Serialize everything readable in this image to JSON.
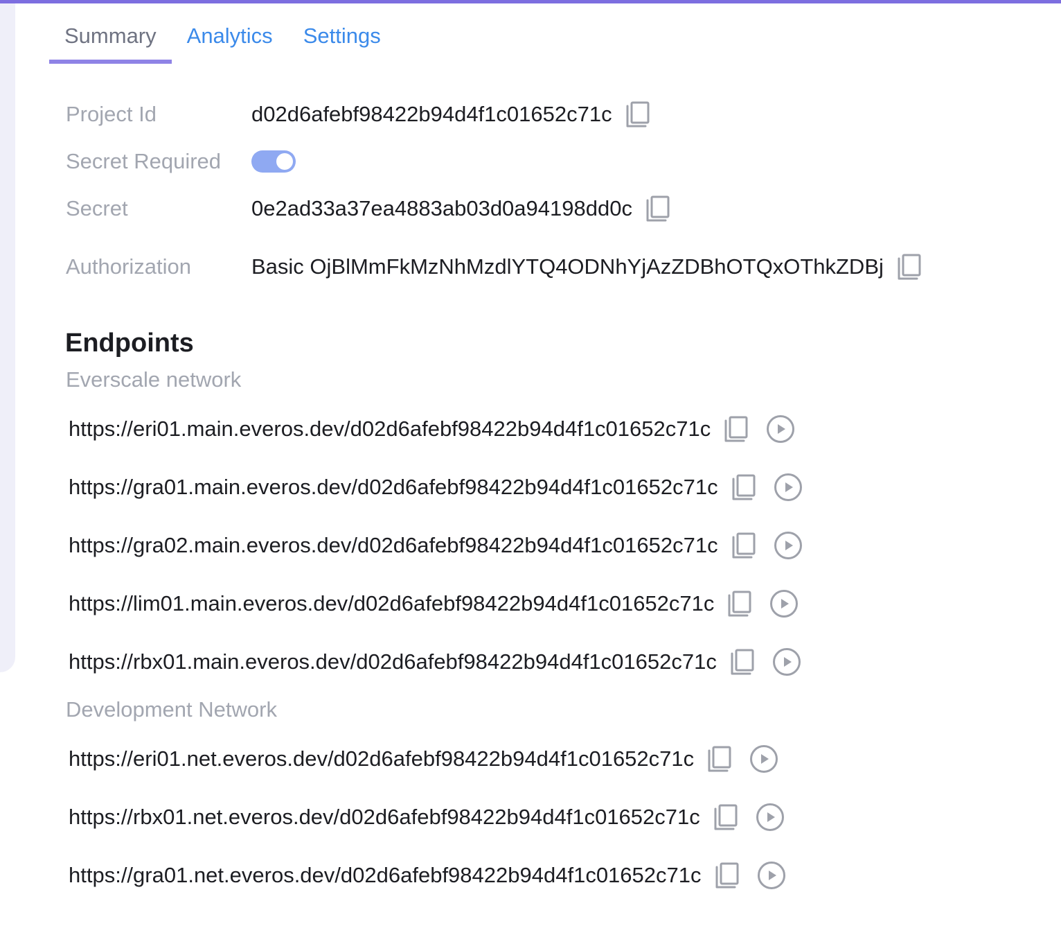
{
  "tabs": [
    {
      "label": "Summary",
      "active": true
    },
    {
      "label": "Analytics",
      "active": false
    },
    {
      "label": "Settings",
      "active": false
    }
  ],
  "project": {
    "project_id_label": "Project Id",
    "project_id": "d02d6afebf98422b94d4f1c01652c71c",
    "secret_required_label": "Secret Required",
    "secret_required": true,
    "secret_label": "Secret",
    "secret": "0e2ad33a37ea4883ab03d0a94198dd0c",
    "authorization_label": "Authorization",
    "authorization": "Basic OjBlMmFkMzNhMzdlYTQ4ODNhYjAzZDBhOTQxOThkZDBj"
  },
  "endpoints": {
    "title": "Endpoints",
    "networks": [
      {
        "name": "Everscale network",
        "urls": [
          "https://eri01.main.everos.dev/d02d6afebf98422b94d4f1c01652c71c",
          "https://gra01.main.everos.dev/d02d6afebf98422b94d4f1c01652c71c",
          "https://gra02.main.everos.dev/d02d6afebf98422b94d4f1c01652c71c",
          "https://lim01.main.everos.dev/d02d6afebf98422b94d4f1c01652c71c",
          "https://rbx01.main.everos.dev/d02d6afebf98422b94d4f1c01652c71c"
        ]
      },
      {
        "name": "Development Network",
        "urls": [
          "https://eri01.net.everos.dev/d02d6afebf98422b94d4f1c01652c71c",
          "https://rbx01.net.everos.dev/d02d6afebf98422b94d4f1c01652c71c",
          "https://gra01.net.everos.dev/d02d6afebf98422b94d4f1c01652c71c"
        ]
      }
    ]
  },
  "icons": {
    "copy": "copy-icon",
    "play": "play-circle-icon"
  },
  "colors": {
    "accent": "#7d6ee0",
    "tab_link": "#3b8aea",
    "toggle_on": "#8fa9f2",
    "label_gray": "#a2a6b0",
    "icon_gray": "#9ea1aa"
  }
}
